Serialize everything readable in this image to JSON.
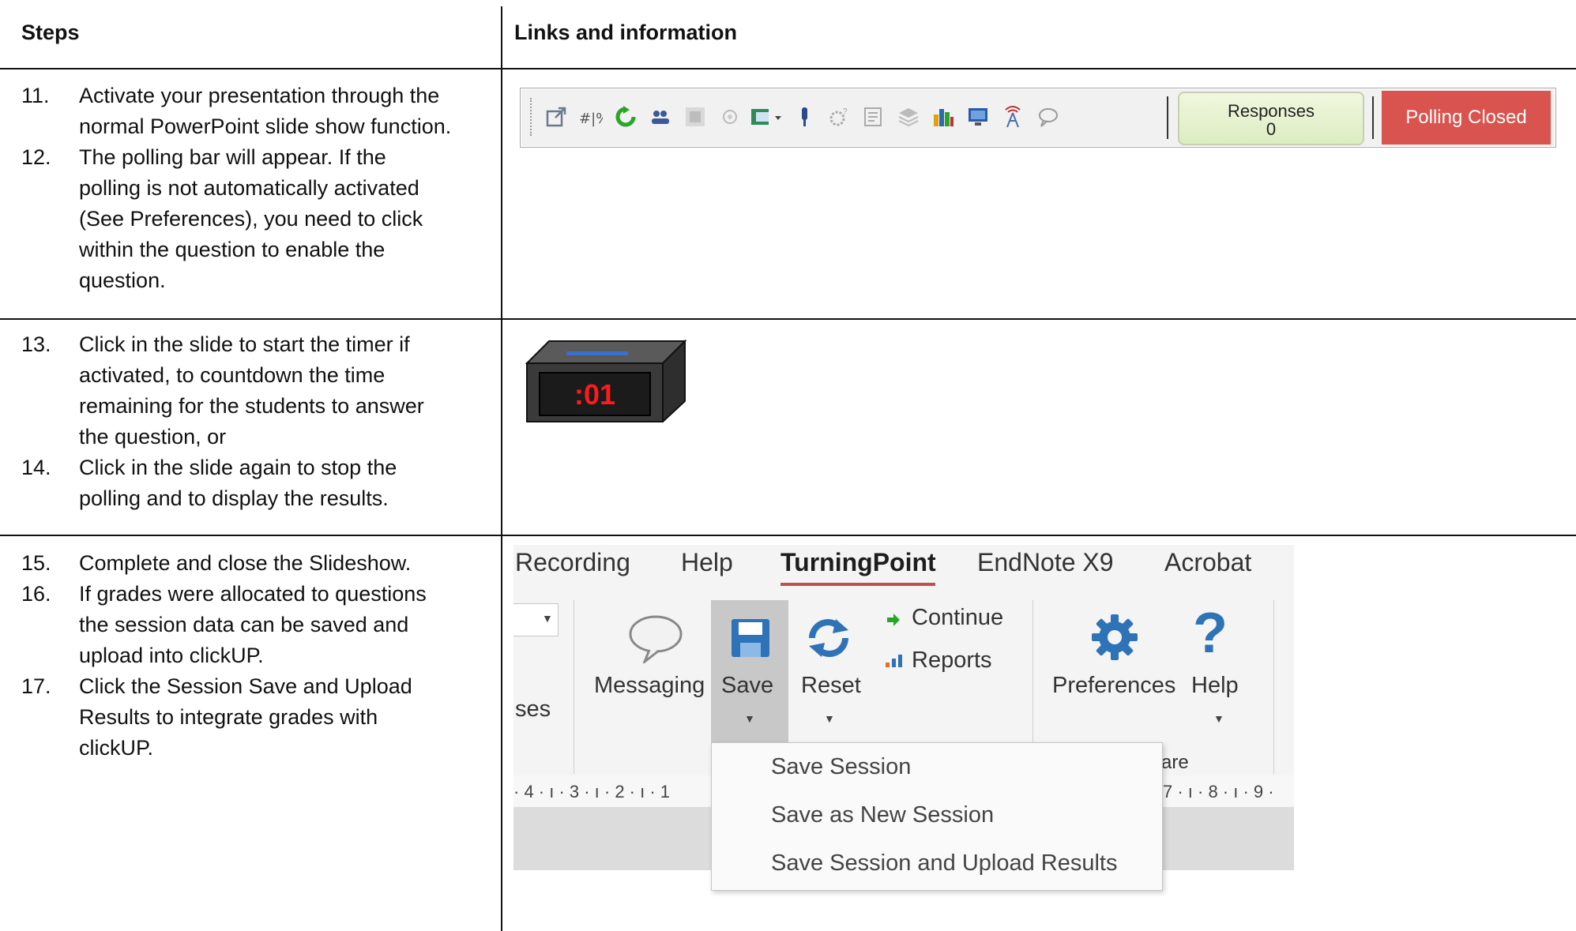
{
  "headers": {
    "steps": "Steps",
    "links": "Links and information"
  },
  "steps": [
    {
      "num": "11.",
      "lines": [
        "Activate your presentation through the",
        "normal PowerPoint slide show function."
      ]
    },
    {
      "num": "12.",
      "lines": [
        "The polling bar will appear. If the",
        "polling is not automatically activated",
        "(See Preferences), you need to click",
        "within the question to enable the",
        "question."
      ]
    },
    {
      "num": "13.",
      "lines": [
        "Click in the slide to start the timer if",
        "activated, to countdown the time",
        "remaining for the students to answer",
        "the question, or"
      ]
    },
    {
      "num": "14.",
      "lines": [
        "Click in the slide again to stop the",
        "polling and to display the results."
      ]
    },
    {
      "num": "15.",
      "lines": [
        "Complete and close the Slideshow."
      ]
    },
    {
      "num": "16.",
      "lines": [
        "If grades were allocated to questions",
        "the session data can be saved and",
        "upload into clickUP."
      ]
    },
    {
      "num": "17.",
      "lines": [
        "Click the Session Save and Upload",
        "Results to integrate grades with",
        "clickUP."
      ]
    }
  ],
  "polling_bar": {
    "icons": [
      "popout-icon",
      "percent-icon",
      "refresh-icon",
      "participants-icon",
      "grid-icon",
      "circle-icon",
      "slide-menu-icon",
      "microphone-icon",
      "gear-question-icon",
      "list-icon",
      "layers-icon",
      "bar-chart-icon",
      "monitor-icon",
      "antenna-icon",
      "speech-bubble-icon"
    ],
    "responses_label": "Responses",
    "responses_count": "0",
    "status": "Polling Closed"
  },
  "timer": {
    "display": ":01"
  },
  "ribbon": {
    "tabs": [
      "Recording",
      "Help",
      "TurningPoint",
      "EndNote X9",
      "Acrobat"
    ],
    "selected_tab": "TurningPoint",
    "partial_left": "ses",
    "partial_group": "are",
    "buttons": {
      "messaging": "Messaging",
      "save": "Save",
      "reset": "Reset",
      "continue": "Continue",
      "reports": "Reports",
      "preferences": "Preferences",
      "help": "Help"
    },
    "save_menu": [
      "Save Session",
      "Save as New Session",
      "Save Session and Upload Results"
    ],
    "ruler_left": "· 4 · ı · 3 · ı · 2 · ı · 1",
    "ruler_right": "7 · ı · 8 · ı · 9 ·"
  },
  "colors": {
    "polling_closed": "#d9534f",
    "tab_underline": "#c0504d",
    "save_blue": "#2e72b8",
    "timer_red": "#ff1a1a"
  }
}
